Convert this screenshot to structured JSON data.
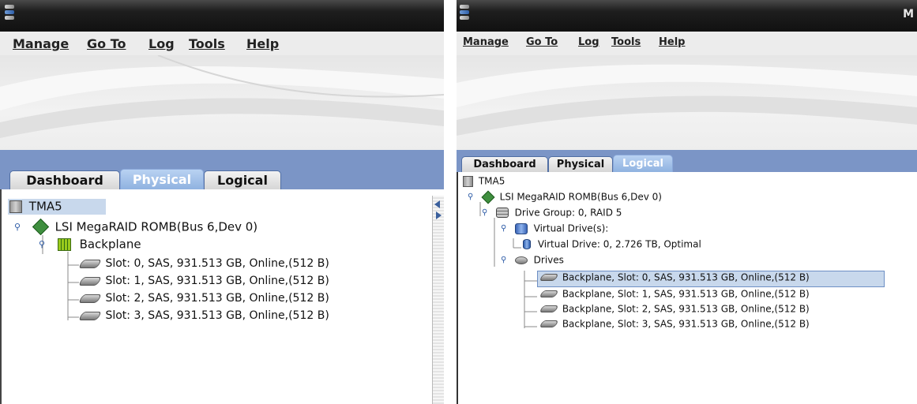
{
  "left_window": {
    "menu": [
      "Manage",
      "Go To",
      "Log",
      "Tools",
      "Help"
    ],
    "tabs": [
      "Dashboard",
      "Physical",
      "Logical"
    ],
    "active_tab": "Physical",
    "tree": {
      "root": "TMA5",
      "controller": "LSI MegaRAID ROMB(Bus 6,Dev 0)",
      "backplane": "Backplane",
      "slots": [
        "Slot: 0, SAS, 931.513 GB, Online,(512 B)",
        "Slot: 1, SAS, 931.513 GB, Online,(512 B)",
        "Slot: 2, SAS, 931.513 GB, Online,(512 B)",
        "Slot: 3, SAS, 931.513 GB, Online,(512 B)"
      ]
    }
  },
  "right_window": {
    "title_fragment": "M",
    "menu": [
      "Manage",
      "Go To",
      "Log",
      "Tools",
      "Help"
    ],
    "tabs": [
      "Dashboard",
      "Physical",
      "Logical"
    ],
    "active_tab": "Logical",
    "tree": {
      "root": "TMA5",
      "controller": "LSI MegaRAID ROMB(Bus 6,Dev 0)",
      "drive_group": "Drive Group: 0, RAID  5",
      "virtual_drives_label": "Virtual Drive(s):",
      "virtual_drive": "Virtual Drive: 0, 2.726 TB, Optimal",
      "drives_label": "Drives",
      "drives": [
        "Backplane, Slot: 0, SAS, 931.513 GB, Online,(512 B)",
        "Backplane, Slot: 1, SAS, 931.513 GB, Online,(512 B)",
        "Backplane, Slot: 2, SAS, 931.513 GB, Online,(512 B)",
        "Backplane, Slot: 3, SAS, 931.513 GB, Online,(512 B)"
      ]
    }
  },
  "colors": {
    "tab_strip": "#7b95c6",
    "active_tab": "#a8c4ea",
    "selection": "#c8d8ec",
    "controller_icon": "#3f8f3f",
    "backplane_icon": "#9acb1c"
  },
  "icons": [
    "app-icon",
    "server-icon",
    "controller-icon",
    "backplane-icon",
    "disk-icon",
    "drive-group-icon",
    "virtual-drives-icon",
    "virtual-drive-icon",
    "drives-folder-icon",
    "tree-expander-icon"
  ]
}
